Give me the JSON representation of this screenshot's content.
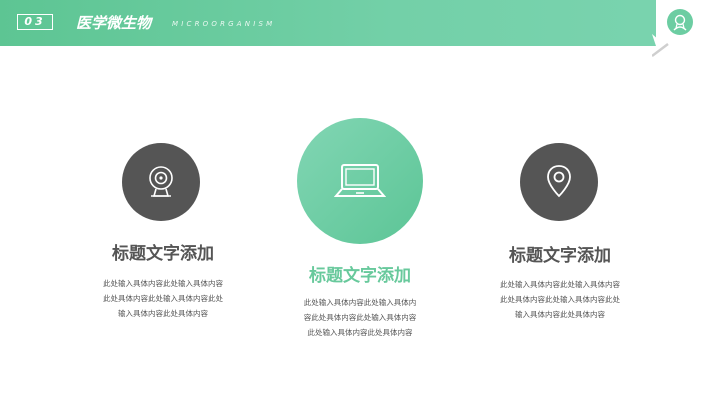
{
  "header": {
    "number": "03",
    "title": "医学微生物",
    "subtitle": "MICROORGANISM",
    "corner_icon": "microbe-icon"
  },
  "features": [
    {
      "icon": "webcam-icon",
      "title": "标题文字添加",
      "lines": [
        "此处输入具体内容此处输入具体内容",
        "此处具体内容此处输入具体内容此处",
        "输入具体内容此处具体内容"
      ]
    },
    {
      "icon": "laptop-icon",
      "title": "标题文字添加",
      "lines": [
        "此处输入具体内容此处输入具体内",
        "容此处具体内容此处输入具体内容",
        "此处输入具体内容此处具体内容"
      ]
    },
    {
      "icon": "map-pin-icon",
      "title": "标题文字添加",
      "lines": [
        "此处输入具体内容此处输入具体内容",
        "此处具体内容此处输入具体内容此处",
        "输入具体内容此处具体内容"
      ]
    }
  ],
  "colors": {
    "accent": "#5dc593",
    "accent_light": "#82d6b4",
    "dark": "#555555"
  }
}
